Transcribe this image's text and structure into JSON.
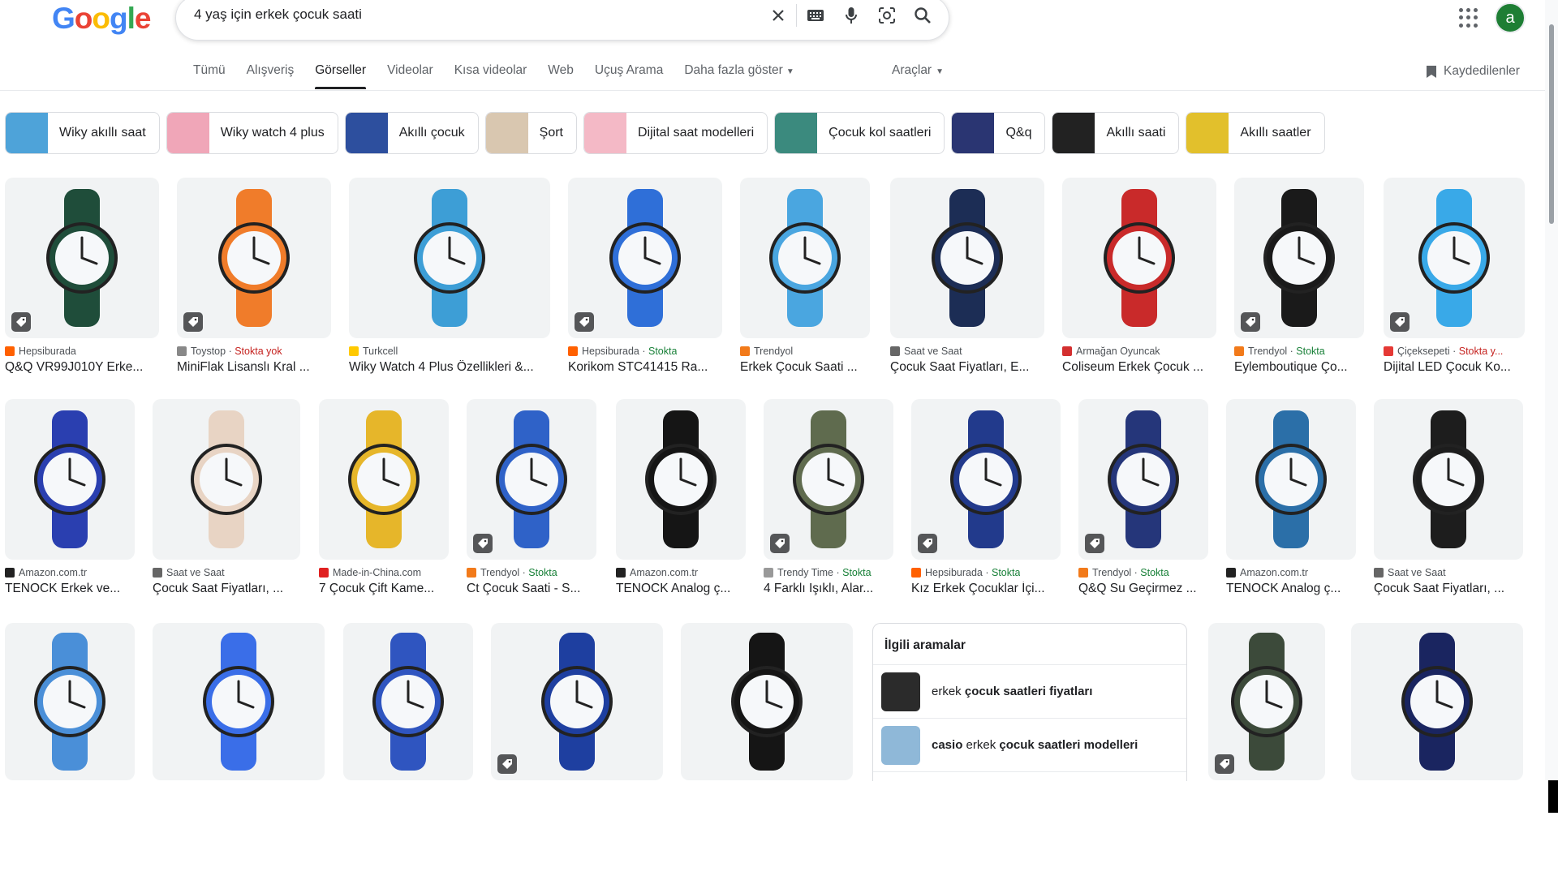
{
  "logo_letters": [
    "G",
    "o",
    "o",
    "g",
    "l",
    "e"
  ],
  "search": {
    "query": "4 yaş için erkek çocuk saati"
  },
  "header": {
    "avatar_letter": "a",
    "saved_label": "Kaydedilenler",
    "tools_label": "Araçlar"
  },
  "tabs": [
    {
      "label": "Tümü"
    },
    {
      "label": "Alışveriş"
    },
    {
      "label": "Görseller",
      "active": true
    },
    {
      "label": "Videolar"
    },
    {
      "label": "Kısa videolar"
    },
    {
      "label": "Web"
    },
    {
      "label": "Uçuş Arama"
    },
    {
      "label": "Daha fazla göster"
    }
  ],
  "chips": [
    {
      "label": "Wiky akıllı saat",
      "color": "#4ea3d9"
    },
    {
      "label": "Wiky watch 4 plus",
      "color": "#f0a6b8"
    },
    {
      "label": "Akıllı çocuk",
      "color": "#2d4f9e"
    },
    {
      "label": "Şort",
      "color": "#d9c7b0"
    },
    {
      "label": "Dijital saat modelleri",
      "color": "#f4b9c6"
    },
    {
      "label": "Çocuk kol saatleri",
      "color": "#3b8a7e"
    },
    {
      "label": "Q&q",
      "color": "#2a3572"
    },
    {
      "label": "Akıllı saati",
      "color": "#222222"
    },
    {
      "label": "Akıllı saatler",
      "color": "#e2c02c"
    }
  ],
  "row1": [
    {
      "source": "Hepsiburada",
      "stock": "",
      "title": "Q&Q VR99J010Y Erke...",
      "color": "#1f4d3a",
      "fav": "#ff6000",
      "tag": true
    },
    {
      "source": "Toystop",
      "stock": "Stokta yok",
      "stock_type": "no",
      "title": "MiniFlak Lisanslı Kral ...",
      "color": "#f07c2a",
      "fav": "#888888",
      "tag": true
    },
    {
      "source": "Turkcell",
      "stock": "",
      "title": "Wiky Watch 4 Plus Özellikleri &...",
      "color": "#3d9ed6",
      "fav": "#ffc900",
      "tag": false
    },
    {
      "source": "Hepsiburada",
      "stock": "Stokta",
      "stock_type": "yes",
      "title": "Korikom STC41415 Ra...",
      "color": "#2f6fd8",
      "fav": "#ff6000",
      "tag": true
    },
    {
      "source": "Trendyol",
      "stock": "",
      "title": "Erkek Çocuk Saati ...",
      "color": "#4aa6e0",
      "fav": "#f27a1a",
      "tag": false
    },
    {
      "source": "Saat ve Saat",
      "stock": "",
      "title": "Çocuk Saat Fiyatları, E...",
      "color": "#1c2d55",
      "fav": "#666666",
      "tag": false
    },
    {
      "source": "Armağan Oyuncak",
      "stock": "",
      "title": "Coliseum Erkek Çocuk ...",
      "color": "#c92a2a",
      "fav": "#d32f2f",
      "tag": false
    },
    {
      "source": "Trendyol",
      "stock": "Stokta",
      "stock_type": "yes",
      "title": "Eylemboutique Ço...",
      "color": "#1a1a1a",
      "fav": "#f27a1a",
      "tag": true
    },
    {
      "source": "Çiçeksepeti",
      "stock": "Stokta y...",
      "stock_type": "no",
      "title": "Dijital LED Çocuk Ko...",
      "color": "#39a9e8",
      "fav": "#e53935",
      "tag": true
    }
  ],
  "row2": [
    {
      "source": "Amazon.com.tr",
      "stock": "",
      "title": "TENOCK Erkek ve...",
      "color": "#2a3fb0",
      "fav": "#222222",
      "tag": false
    },
    {
      "source": "Saat ve Saat",
      "stock": "",
      "title": "Çocuk Saat Fiyatları, ...",
      "color": "#e8d4c4",
      "fav": "#666666",
      "tag": false
    },
    {
      "source": "Made-in-China.com",
      "stock": "",
      "title": "7 Çocuk Çift Kame...",
      "color": "#e6b62a",
      "fav": "#e02020",
      "tag": false
    },
    {
      "source": "Trendyol",
      "stock": "Stokta",
      "stock_type": "yes",
      "title": "Ct Çocuk Saati - S...",
      "color": "#2f62c8",
      "fav": "#f27a1a",
      "tag": true
    },
    {
      "source": "Amazon.com.tr",
      "stock": "",
      "title": "TENOCK Analog ç...",
      "color": "#151515",
      "fav": "#222222",
      "tag": false
    },
    {
      "source": "Trendy Time",
      "stock": "Stokta",
      "stock_type": "yes",
      "title": "4 Farklı Işıklı, Alar...",
      "color": "#5f6b4e",
      "fav": "#999999",
      "tag": true
    },
    {
      "source": "Hepsiburada",
      "stock": "Stokta",
      "stock_type": "yes",
      "title": "Kız Erkek Çocuklar İçi...",
      "color": "#223a8c",
      "fav": "#ff6000",
      "tag": true
    },
    {
      "source": "Trendyol",
      "stock": "Stokta",
      "stock_type": "yes",
      "title": "Q&Q Su Geçirmez ...",
      "color": "#25367a",
      "fav": "#f27a1a",
      "tag": true
    },
    {
      "source": "Amazon.com.tr",
      "stock": "",
      "title": "TENOCK Analog ç...",
      "color": "#2b6fa8",
      "fav": "#222222",
      "tag": false
    },
    {
      "source": "Saat ve Saat",
      "stock": "",
      "title": "Çocuk Saat Fiyatları, ...",
      "color": "#1d1d1d",
      "fav": "#666666",
      "tag": false
    }
  ],
  "row3": [
    {
      "color": "#4a8fd8",
      "tag": false
    },
    {
      "color": "#3a6ee8",
      "tag": false
    },
    {
      "color": "#2f55c0",
      "tag": false
    },
    {
      "color": "#1e3fa0",
      "tag": true
    },
    {
      "color": "#151515",
      "tag": false
    },
    {
      "color": "#3c4a3a",
      "tag": true
    },
    {
      "color": "#1a2560",
      "tag": false
    }
  ],
  "related": {
    "title": "İlgili aramalar",
    "items": [
      {
        "pre": "erkek ",
        "bold": "çocuk saatleri fiyatları",
        "post": "",
        "color": "#2b2b2b"
      },
      {
        "pre": "",
        "bold": "casio",
        "post": " erkek ",
        "bold2": "çocuk saatleri modelleri",
        "color": "#8fb8d8"
      }
    ]
  }
}
